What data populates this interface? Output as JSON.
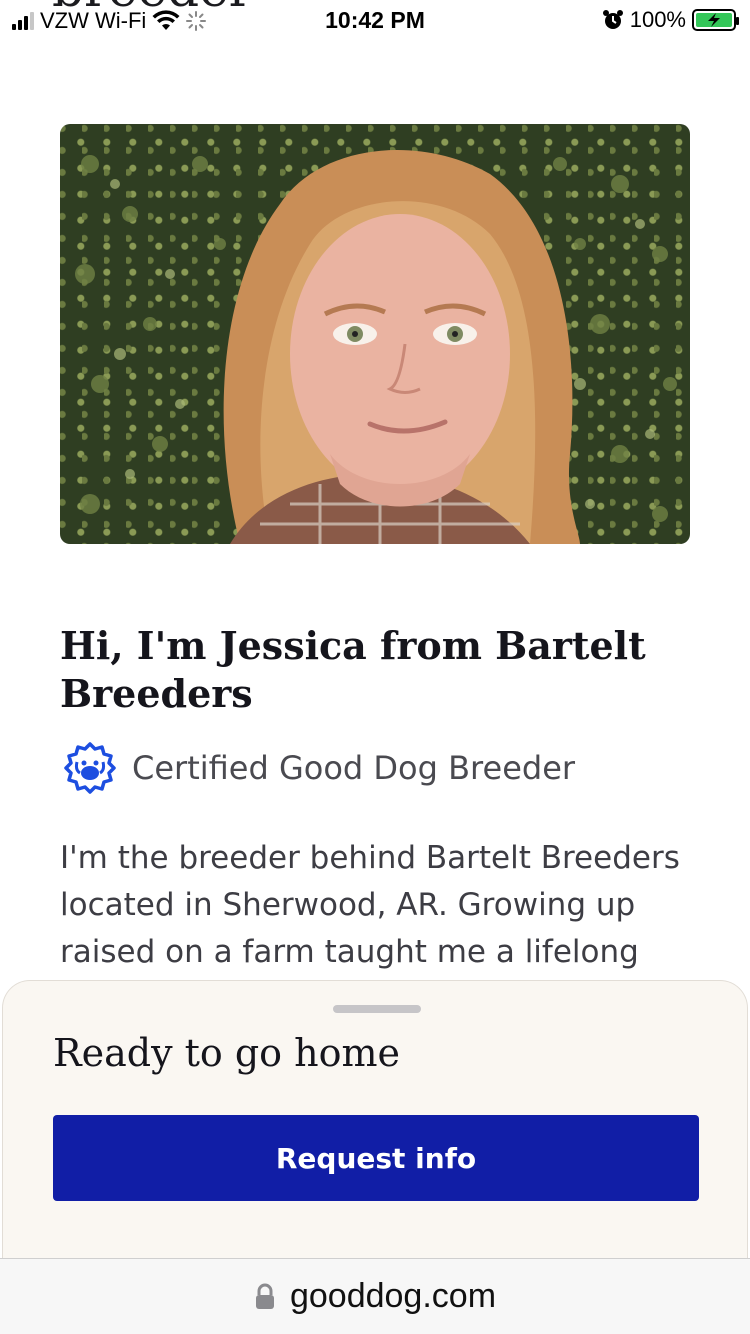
{
  "status_bar": {
    "carrier": "VZW Wi-Fi",
    "time": "10:42 PM",
    "battery": "100%"
  },
  "page": {
    "clipped_title": "breeder",
    "heading": "Hi, I'm Jessica from Bartelt Breeders",
    "certified_label": "Certified Good Dog Breeder",
    "bio": "I'm the breeder behind Bartelt Breeders located in Sherwood, AR. Growing up raised on a farm taught me a lifelong"
  },
  "sheet": {
    "title": "Ready to go home",
    "cta_label": "Request info"
  },
  "browser": {
    "url": "gooddog.com"
  },
  "colors": {
    "cta": "#111ea6",
    "badge": "#1d4ee0",
    "sheet_bg": "#faf7f2"
  },
  "icons": [
    "signal-icon",
    "wifi-icon",
    "loading-icon",
    "alarm-icon",
    "battery-icon",
    "certified-badge-icon",
    "lock-icon"
  ]
}
